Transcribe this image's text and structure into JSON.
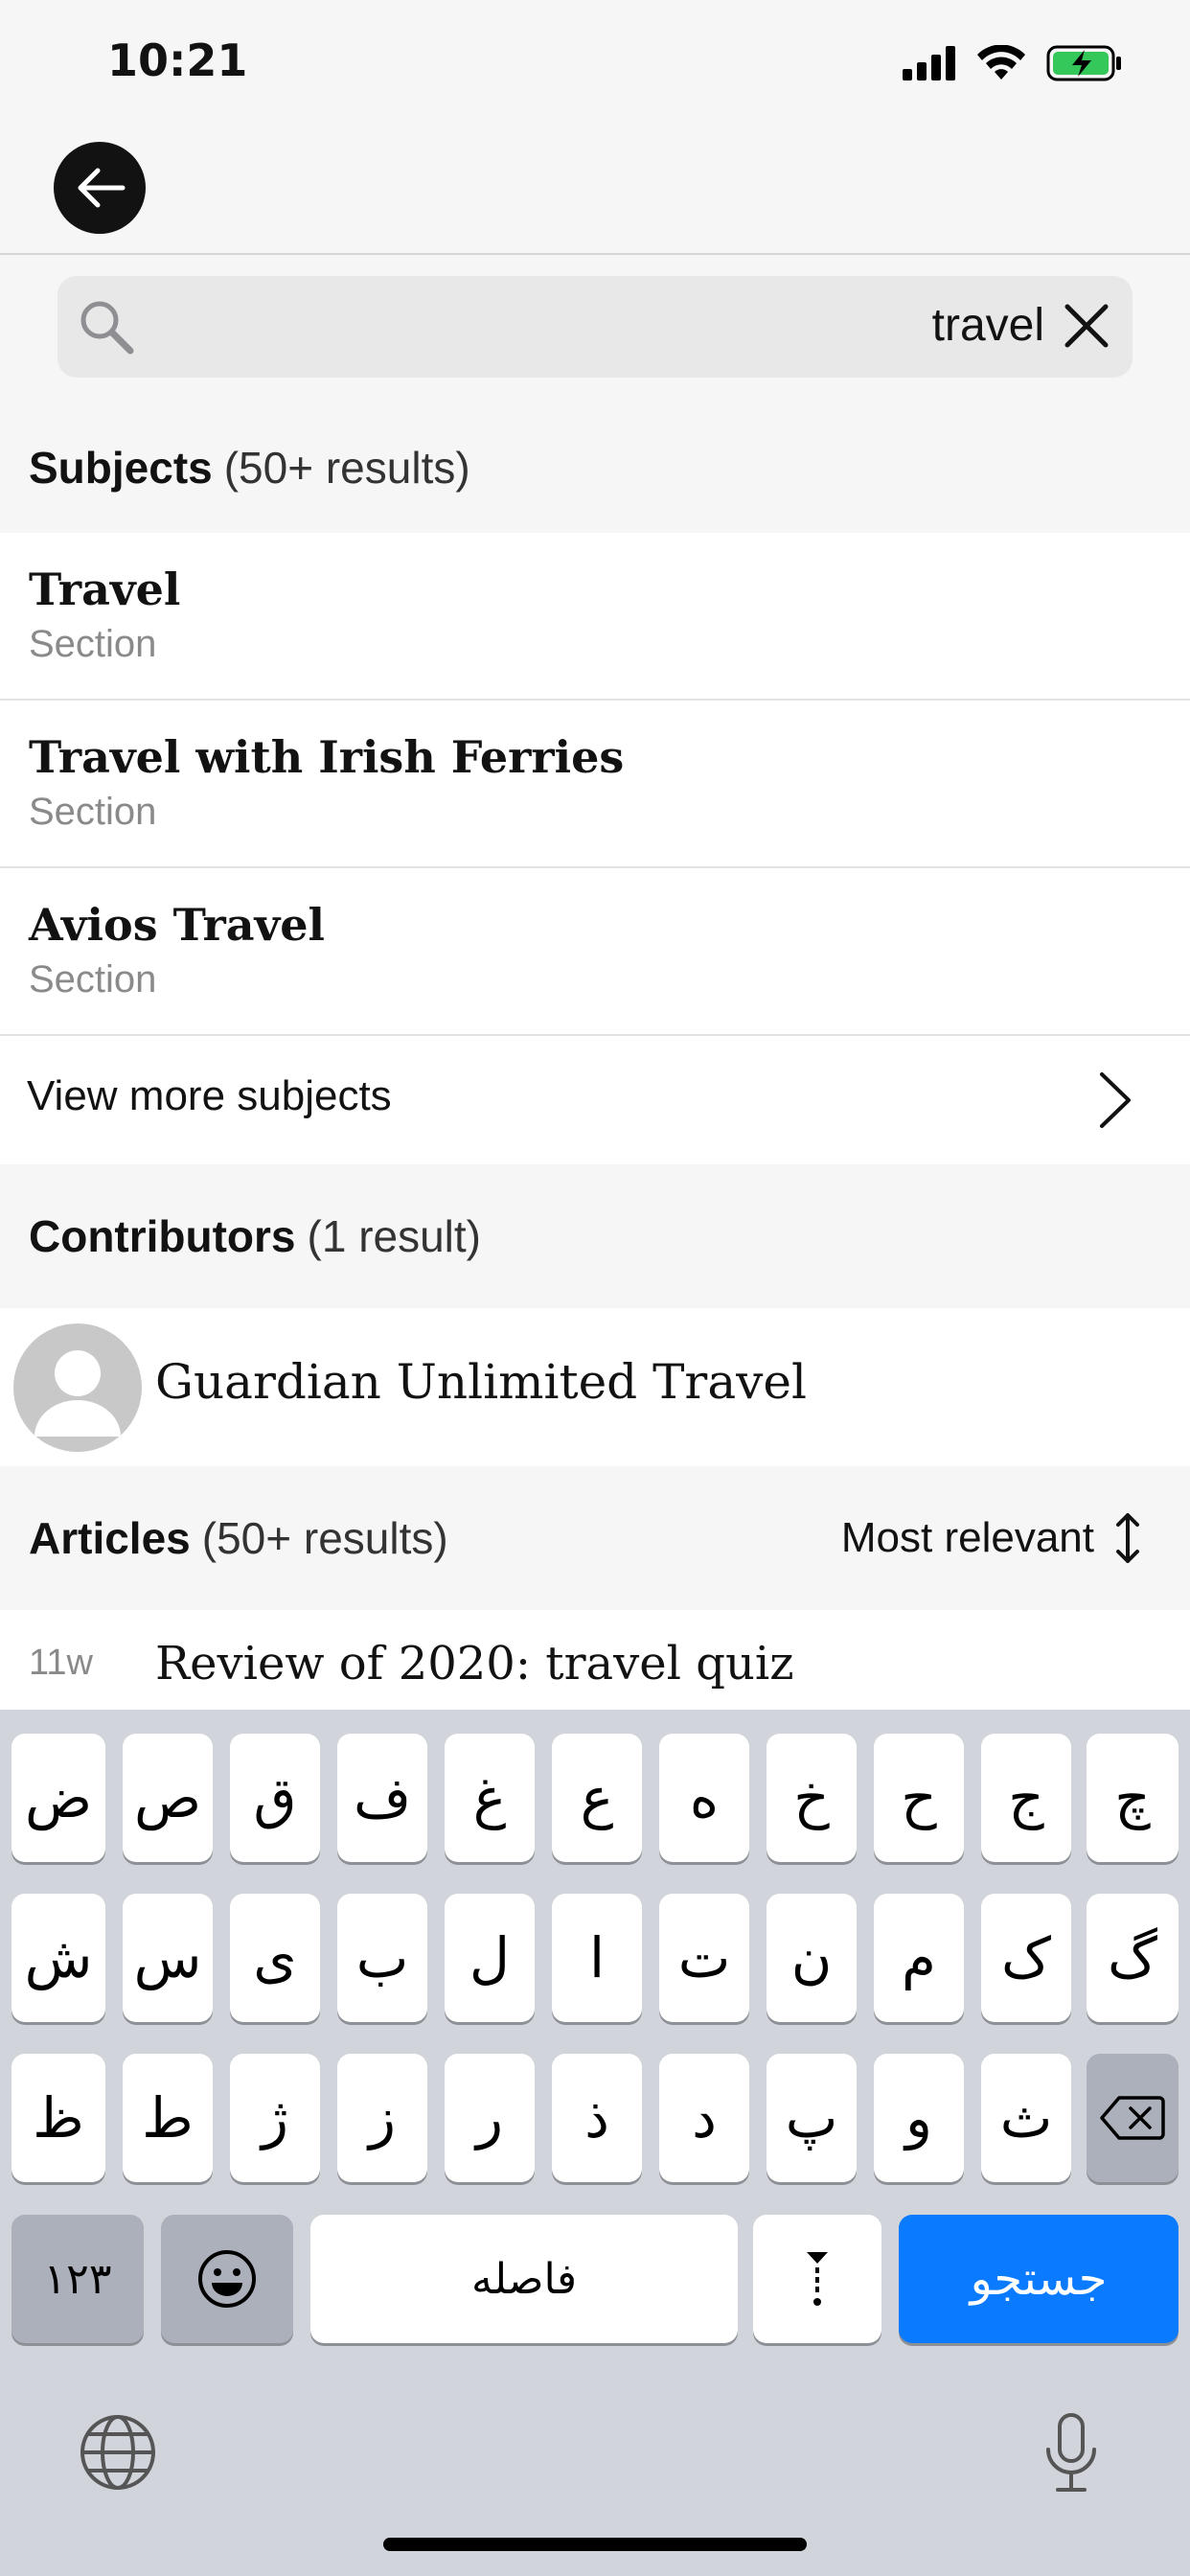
{
  "status_bar": {
    "time": "10:21"
  },
  "search": {
    "value": "travel"
  },
  "subjects": {
    "heading": "Subjects",
    "count": "(50+ results)",
    "items": [
      {
        "title": "Travel",
        "type": "Section"
      },
      {
        "title": "Travel with Irish Ferries",
        "type": "Section"
      },
      {
        "title": "Avios Travel",
        "type": "Section"
      }
    ],
    "view_more": "View more subjects"
  },
  "contributors": {
    "heading": "Contributors",
    "count": "(1 result)",
    "items": [
      {
        "name": "Guardian Unlimited Travel"
      }
    ]
  },
  "articles": {
    "heading": "Articles",
    "count": "(50+ results)",
    "sort_label": "Most relevant",
    "items": [
      {
        "age": "11w",
        "title": "Review of 2020: travel quiz"
      }
    ]
  },
  "keyboard": {
    "row1": [
      "ض",
      "ص",
      "ق",
      "ف",
      "غ",
      "ع",
      "ه",
      "خ",
      "ح",
      "ج",
      "چ"
    ],
    "row2": [
      "ش",
      "س",
      "ی",
      "ب",
      "ل",
      "ا",
      "ت",
      "ن",
      "م",
      "ک",
      "گ"
    ],
    "row3": [
      "ظ",
      "ط",
      "ژ",
      "ز",
      "ر",
      "ذ",
      "د",
      "پ",
      "و",
      "ث"
    ],
    "numbers_key": "۱۲۳",
    "space_key": "فاصله",
    "return_key": "جستجو",
    "accent_color": "#0a7aff"
  }
}
